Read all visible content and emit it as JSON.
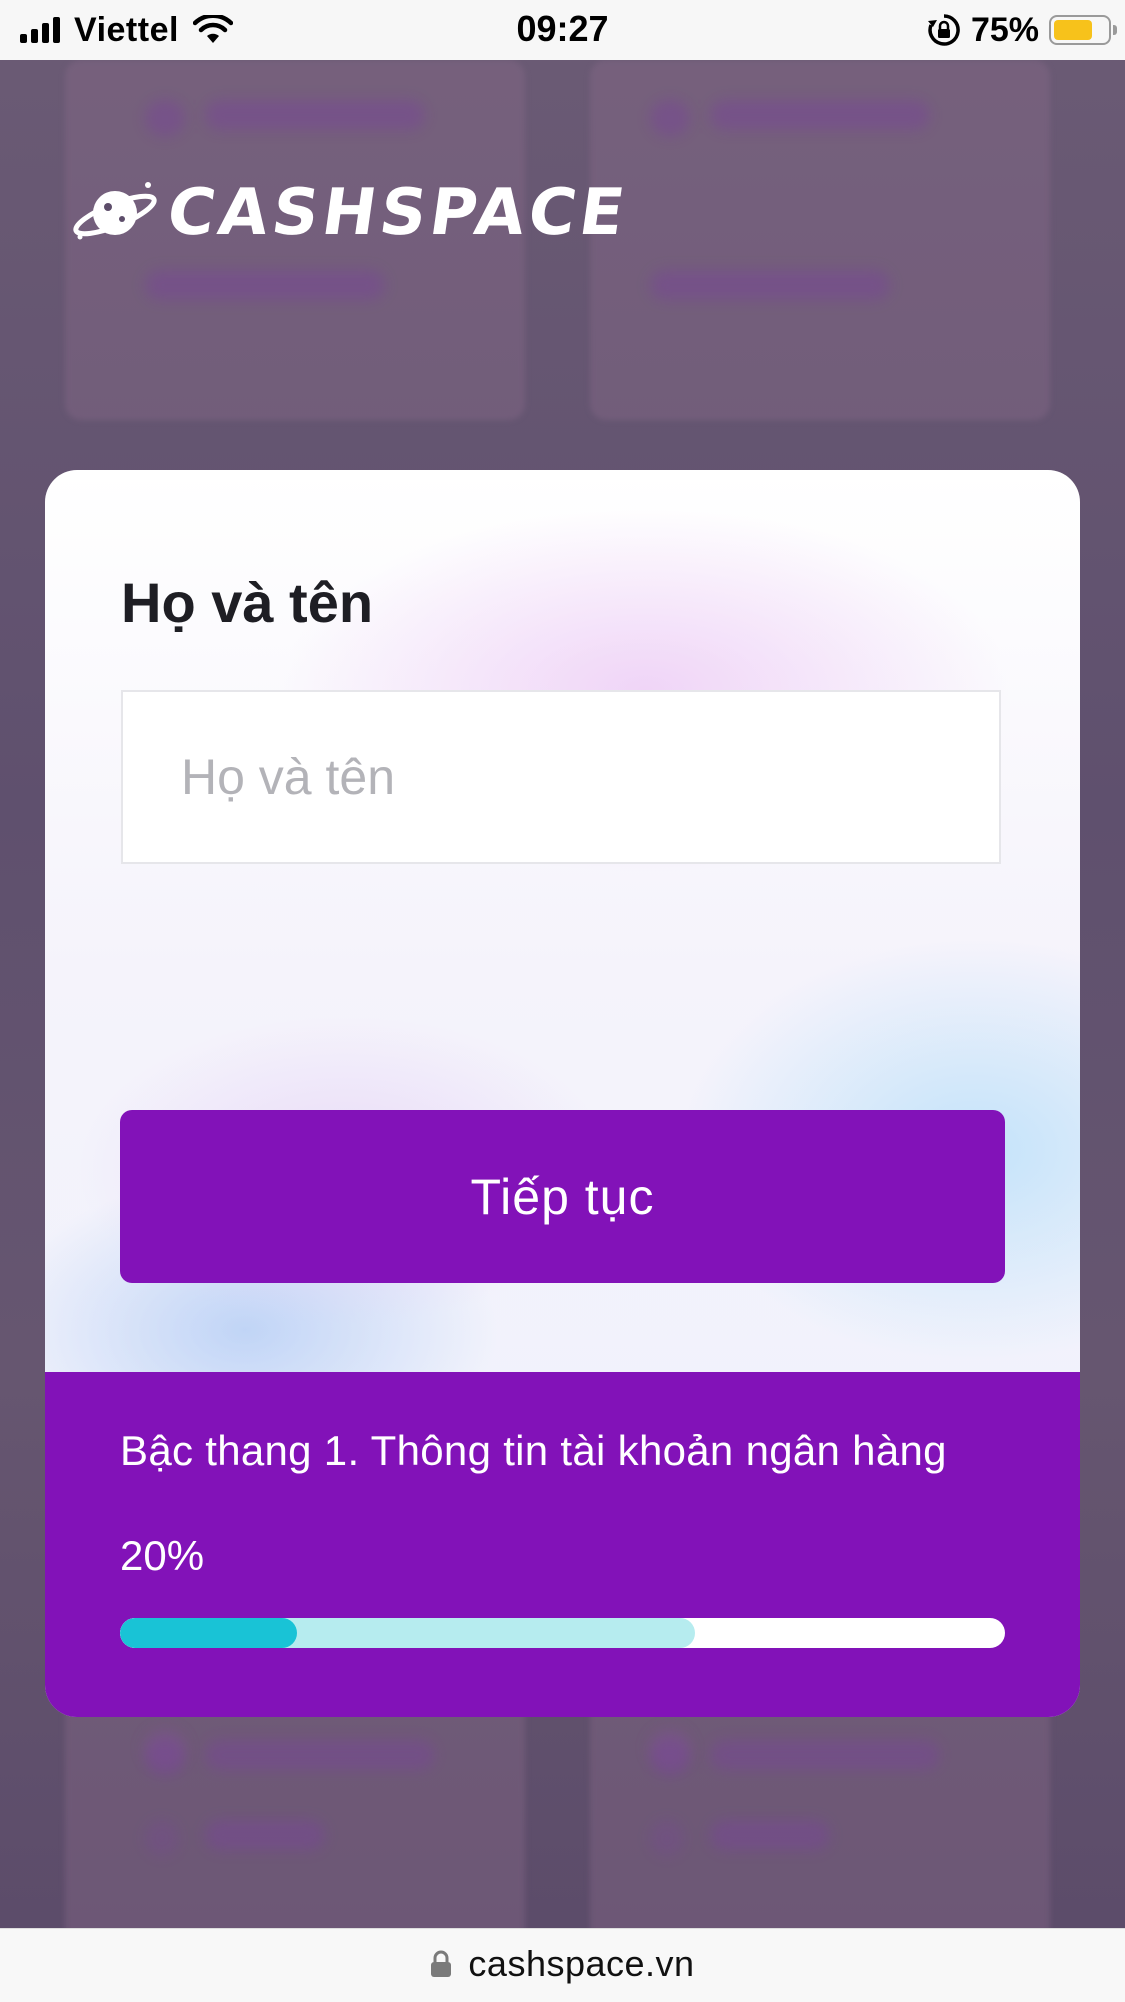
{
  "status_bar": {
    "carrier": "Viettel",
    "time": "09:27",
    "battery_percent_label": "75%",
    "battery_level": 0.75,
    "battery_color": "#f7c21b",
    "icons": [
      "signal-icon",
      "wifi-icon",
      "rotation-lock-icon",
      "battery-icon"
    ]
  },
  "brand": {
    "logo_text": "CASHSPACE",
    "logo_icon": "planet-icon"
  },
  "form": {
    "field_label": "Họ và tên",
    "name_input": {
      "value": "",
      "placeholder": "Họ và tên"
    },
    "continue_label": "Tiếp tục"
  },
  "progress": {
    "step_text": "Bậc thang 1. Thông tin tài khoản ngân hàng",
    "percent_label": "20%",
    "value": 0.2,
    "buffer": 0.65,
    "colors": {
      "fill": "#19c3d6",
      "buffer": "#b6ecef",
      "track": "#ffffff",
      "panel": "#8212b8"
    }
  },
  "browser": {
    "url": "cashspace.vn",
    "lock_icon": "lock-icon"
  },
  "theme": {
    "accent": "#8212b8"
  }
}
